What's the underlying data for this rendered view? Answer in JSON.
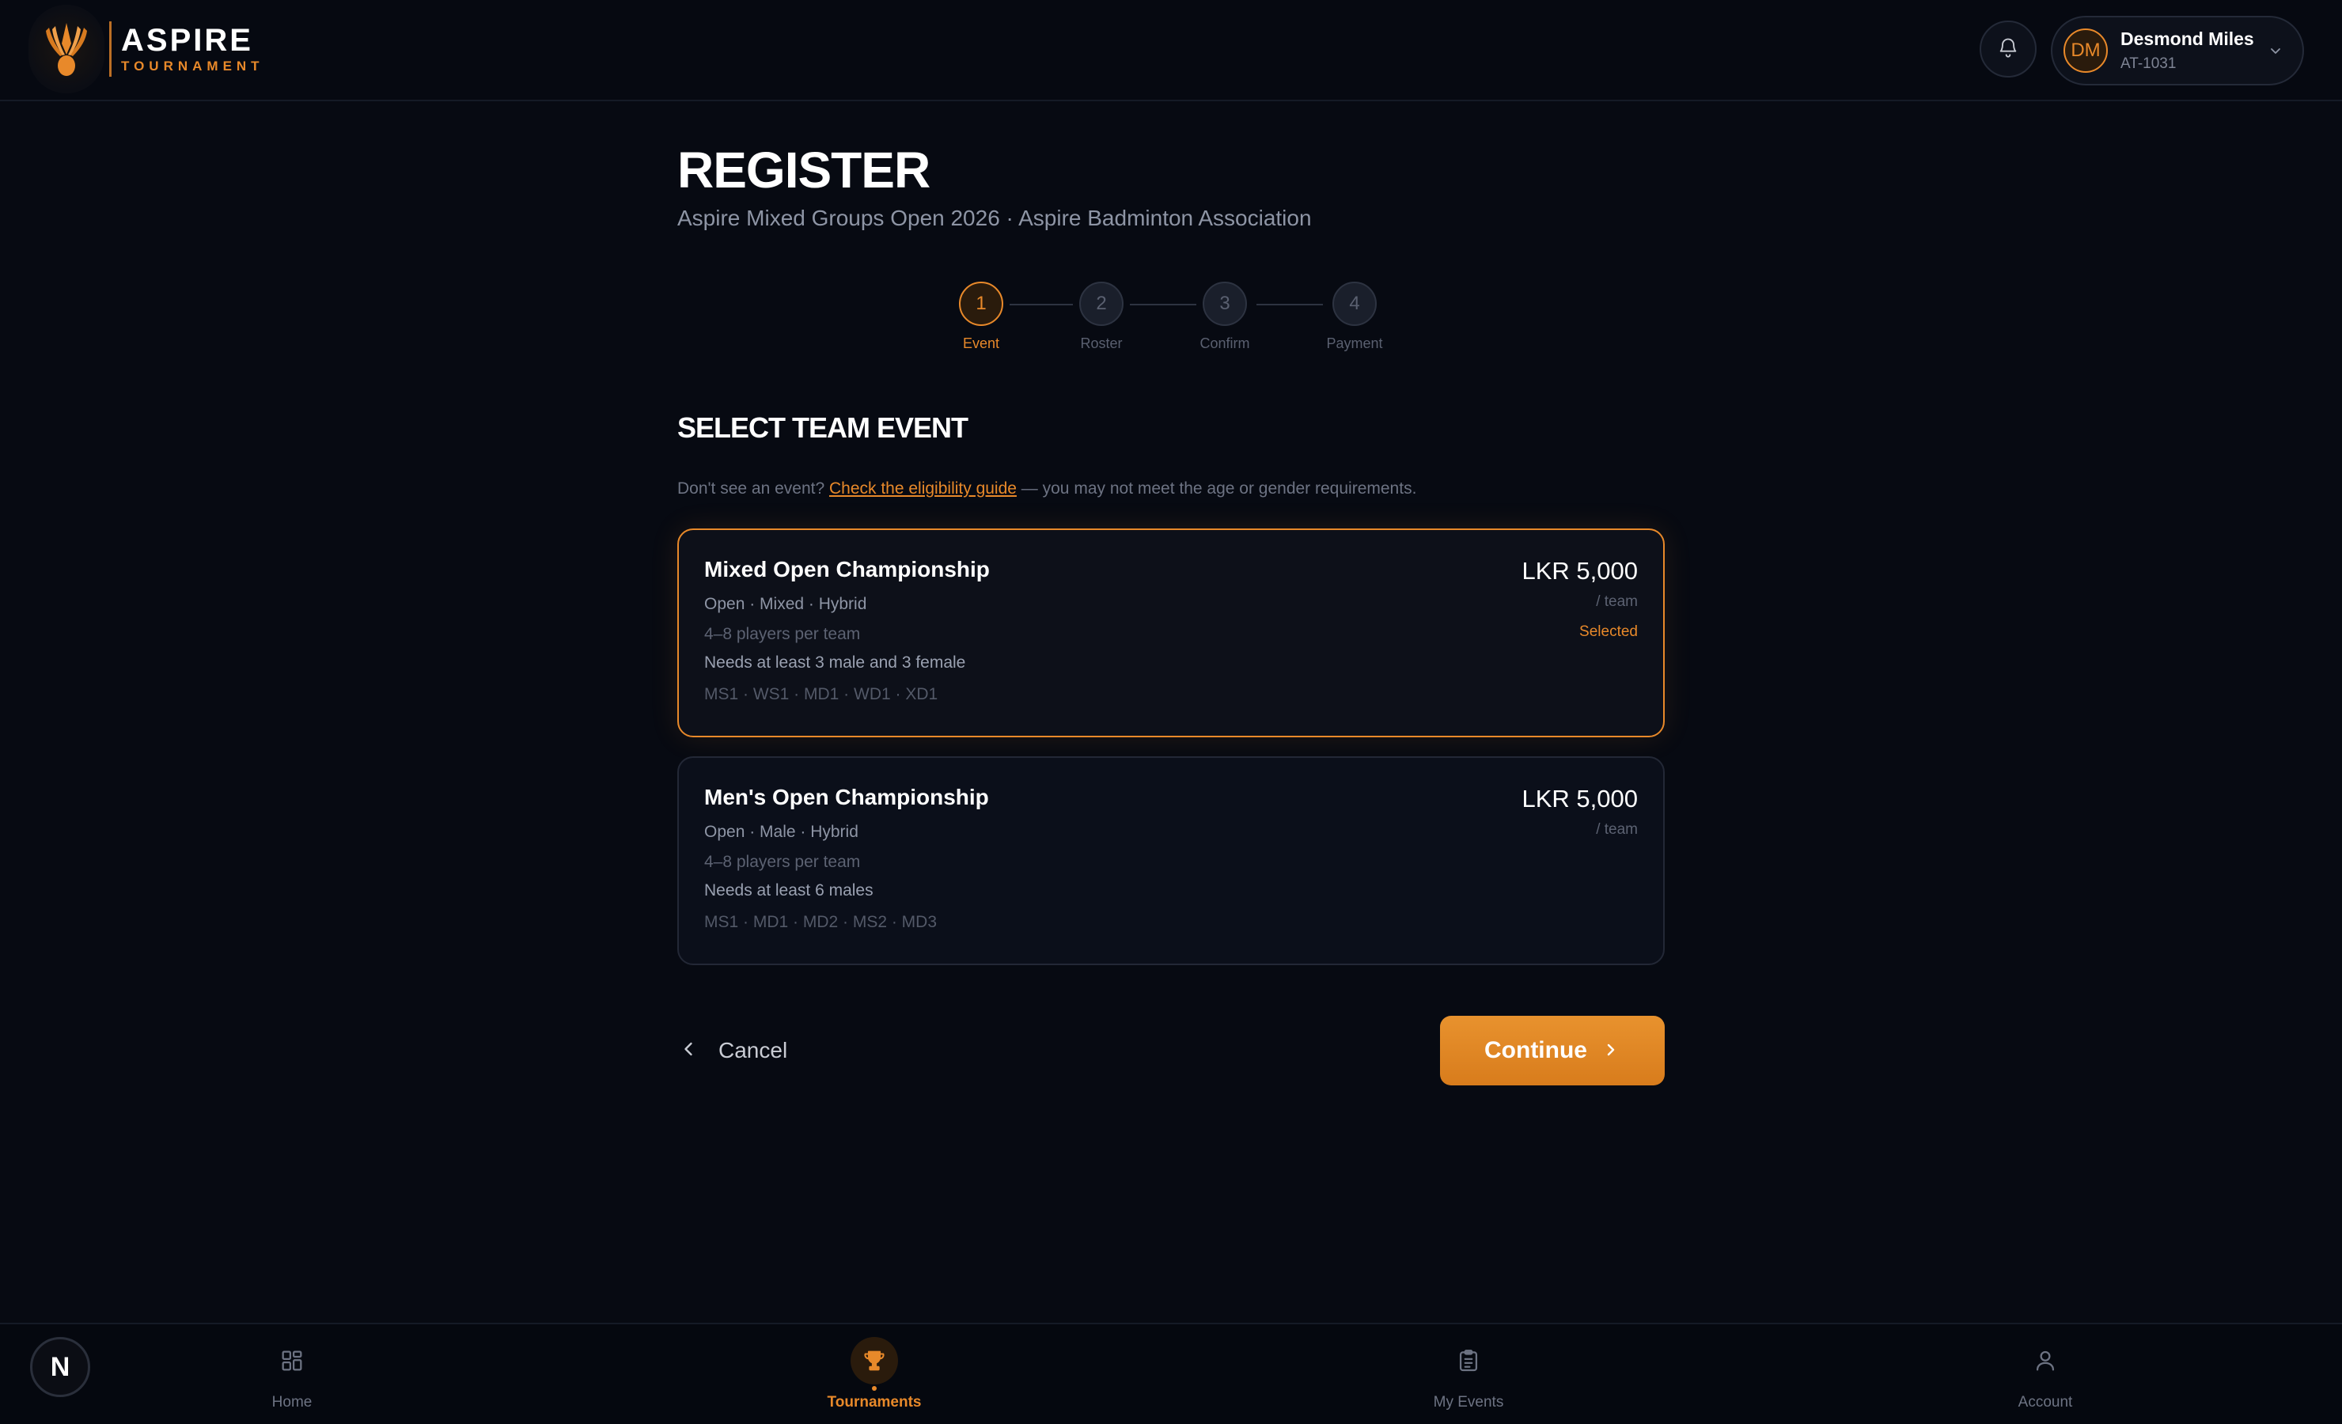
{
  "brand": {
    "title": "ASPIRE",
    "subtitle": "TOURNAMENT"
  },
  "header": {
    "user": {
      "initials": "DM",
      "name": "Desmond Miles",
      "id": "AT-1031"
    }
  },
  "page": {
    "title": "REGISTER",
    "subtitle": "Aspire Mixed Groups Open 2026 · Aspire Badminton Association"
  },
  "stepper": {
    "current": 1,
    "steps": [
      {
        "number": "1",
        "label": "Event"
      },
      {
        "number": "2",
        "label": "Roster"
      },
      {
        "number": "3",
        "label": "Confirm"
      },
      {
        "number": "4",
        "label": "Payment"
      }
    ]
  },
  "section": {
    "title": "SELECT TEAM EVENT",
    "eligibility_prefix": "Don't see an event?",
    "eligibility_link": "Check the eligibility guide",
    "eligibility_suffix": "— you may not meet the age or gender requirements."
  },
  "events": [
    {
      "title": "Mixed Open Championship",
      "meta": "Open · Mixed · Hybrid",
      "players": "4–8 players per team",
      "requirement": "Needs at least 3 male and 3 female",
      "disciplines": "MS1 · WS1 · MD1 · WD1 · XD1",
      "price": "LKR 5,000",
      "per": "/ team",
      "status": "Selected",
      "selected": true
    },
    {
      "title": "Men's Open Championship",
      "meta": "Open · Male · Hybrid",
      "players": "4–8 players per team",
      "requirement": "Needs at least 6 males",
      "disciplines": "MS1 · MD1 · MD2 · MS2 · MD3",
      "price": "LKR 5,000",
      "per": "/ team",
      "status": "",
      "selected": false
    }
  ],
  "actions": {
    "cancel": "Cancel",
    "continue": "Continue"
  },
  "nav": {
    "badge": "N",
    "items": [
      {
        "label": "Home",
        "icon": "grid-icon"
      },
      {
        "label": "Tournaments",
        "icon": "trophy-icon",
        "active": true
      },
      {
        "label": "My Events",
        "icon": "clipboard-icon"
      },
      {
        "label": "Account",
        "icon": "user-icon"
      }
    ]
  },
  "colors": {
    "accent": "#e8892a",
    "background": "#070a12",
    "card": "#0b0f1a"
  }
}
